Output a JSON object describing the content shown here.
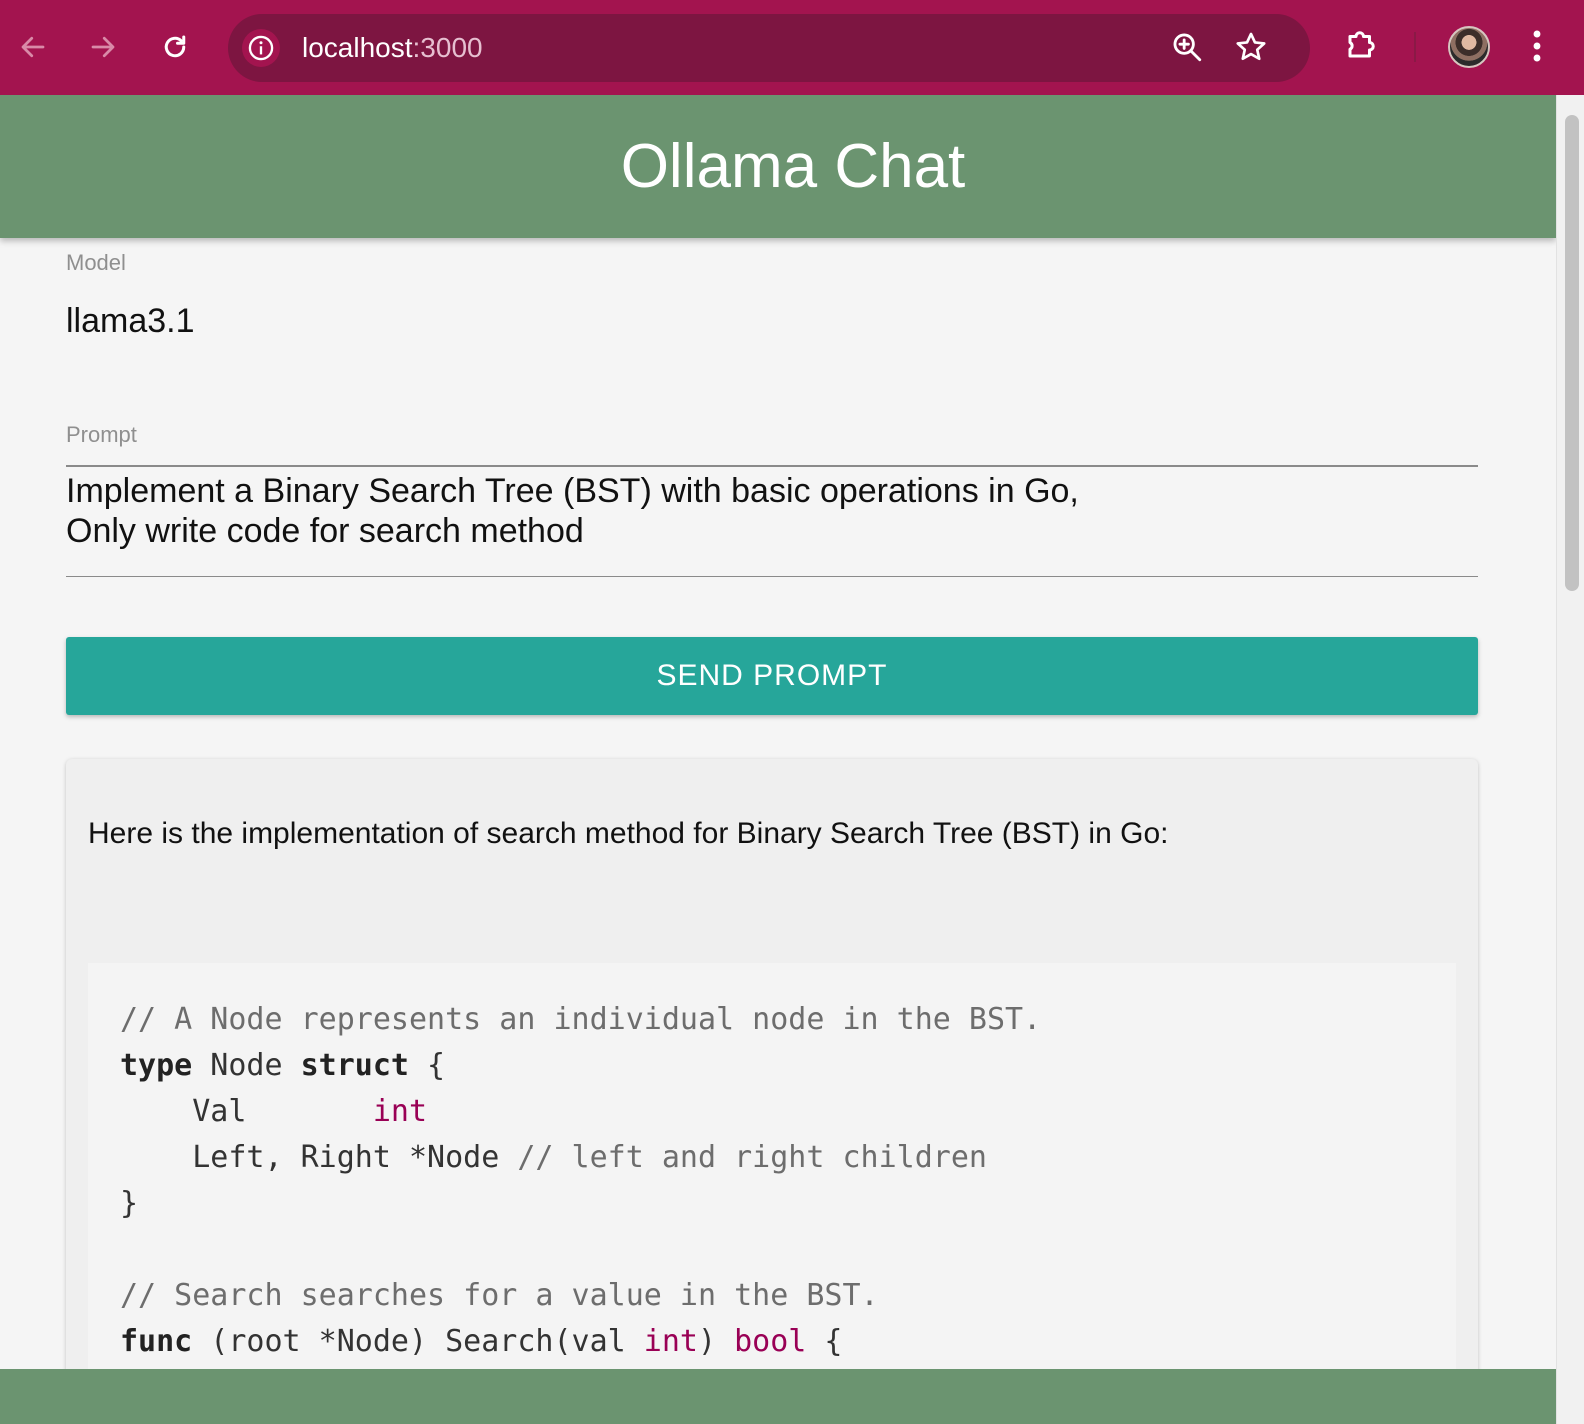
{
  "browser": {
    "url_host": "localhost",
    "url_port": ":3000",
    "icons": {
      "back": "arrow-left-icon",
      "forward": "arrow-right-icon",
      "reload": "reload-icon",
      "site_info": "info-icon",
      "zoom": "zoom-in-icon",
      "bookmark": "star-icon",
      "extensions": "puzzle-icon",
      "menu": "kebab-menu-icon"
    },
    "colors": {
      "toolbar": "#a3144f",
      "omnibox": "#7d1541"
    }
  },
  "app": {
    "title": "Ollama Chat",
    "colors": {
      "header": "#6b9470",
      "button": "#26a69a"
    }
  },
  "form": {
    "model_label": "Model",
    "model_value": "llama3.1",
    "prompt_label": "Prompt",
    "prompt_value": "Implement a Binary Search Tree (BST) with basic operations in Go,\nOnly write code for search method",
    "send_label": "SEND PROMPT"
  },
  "response": {
    "intro": "Here is the implementation of search method for Binary Search Tree (BST) in Go:",
    "code": {
      "line1": "// A Node represents an individual node in the BST.",
      "line2_kw": "type",
      "line2_name": " Node ",
      "line2_kw2": "struct",
      "line2_rest": " {",
      "line3_field": "    Val       ",
      "line3_type": "int",
      "line4_code": "    Left, Right *Node ",
      "line4_comment": "// left and right children",
      "line5": "}",
      "line7": "// Search searches for a value in the BST.",
      "line8_kw": "func",
      "line8_a": " (root *Node) Search(val ",
      "line8_type": "int",
      "line8_b": ") ",
      "line8_type2": "bool",
      "line8_c": " {"
    }
  }
}
